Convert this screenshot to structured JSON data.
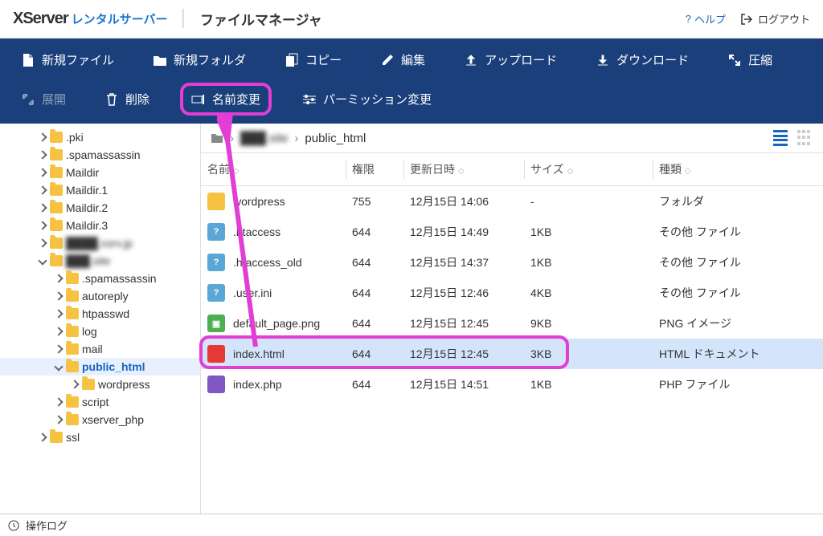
{
  "header": {
    "logo_main": "XServer",
    "logo_sub": "レンタルサーバー",
    "page_title": "ファイルマネージャ",
    "help": "ヘルプ",
    "logout": "ログアウト"
  },
  "toolbar": {
    "new_file": "新規ファイル",
    "new_folder": "新規フォルダ",
    "copy": "コピー",
    "edit": "編集",
    "upload": "アップロード",
    "download": "ダウンロード",
    "compress": "圧縮",
    "expand": "展開",
    "delete": "削除",
    "rename": "名前変更",
    "permission": "パーミッション変更"
  },
  "sidebar": {
    "items": [
      {
        "label": ".pki",
        "indent": 1,
        "expanded": false
      },
      {
        "label": ".spamassassin",
        "indent": 1,
        "expanded": false
      },
      {
        "label": "Maildir",
        "indent": 1,
        "expanded": false
      },
      {
        "label": "Maildir.1",
        "indent": 1,
        "expanded": false
      },
      {
        "label": "Maildir.2",
        "indent": 1,
        "expanded": false
      },
      {
        "label": "Maildir.3",
        "indent": 1,
        "expanded": false
      },
      {
        "label": "████.xsrv.jp",
        "indent": 1,
        "expanded": false,
        "blur": true
      },
      {
        "label": "███.site",
        "indent": 1,
        "expanded": true,
        "blur": true
      },
      {
        "label": ".spamassassin",
        "indent": 2,
        "expanded": false
      },
      {
        "label": "autoreply",
        "indent": 2,
        "expanded": false
      },
      {
        "label": "htpasswd",
        "indent": 2,
        "expanded": false
      },
      {
        "label": "log",
        "indent": 2,
        "expanded": false
      },
      {
        "label": "mail",
        "indent": 2,
        "expanded": false
      },
      {
        "label": "public_html",
        "indent": 2,
        "expanded": true,
        "selected": true
      },
      {
        "label": "wordpress",
        "indent": 3,
        "expanded": false
      },
      {
        "label": "script",
        "indent": 2,
        "expanded": false
      },
      {
        "label": "xserver_php",
        "indent": 2,
        "expanded": false
      },
      {
        "label": "ssl",
        "indent": 1,
        "expanded": false
      }
    ]
  },
  "breadcrumb": {
    "parts": [
      "███.site",
      "public_html"
    ]
  },
  "table": {
    "headers": {
      "name": "名前",
      "perm": "権限",
      "date": "更新日時",
      "size": "サイズ",
      "type": "種類"
    },
    "rows": [
      {
        "name": "wordpress",
        "perm": "755",
        "date": "12月15日 14:06",
        "size": "-",
        "type": "フォルダ",
        "ico": "folder"
      },
      {
        "name": ".htaccess",
        "perm": "644",
        "date": "12月15日 14:49",
        "size": "1KB",
        "type": "その他 ファイル",
        "ico": "unknown"
      },
      {
        "name": ".htaccess_old",
        "perm": "644",
        "date": "12月15日 14:37",
        "size": "1KB",
        "type": "その他 ファイル",
        "ico": "unknown"
      },
      {
        "name": ".user.ini",
        "perm": "644",
        "date": "12月15日 12:46",
        "size": "4KB",
        "type": "その他 ファイル",
        "ico": "unknown"
      },
      {
        "name": "default_page.png",
        "perm": "644",
        "date": "12月15日 12:45",
        "size": "9KB",
        "type": "PNG イメージ",
        "ico": "png"
      },
      {
        "name": "index.html",
        "perm": "644",
        "date": "12月15日 12:45",
        "size": "3KB",
        "type": "HTML ドキュメント",
        "ico": "html",
        "selected": true
      },
      {
        "name": "index.php",
        "perm": "644",
        "date": "12月15日 14:51",
        "size": "1KB",
        "type": "PHP ファイル",
        "ico": "php"
      }
    ]
  },
  "footer": {
    "log": "操作ログ"
  }
}
